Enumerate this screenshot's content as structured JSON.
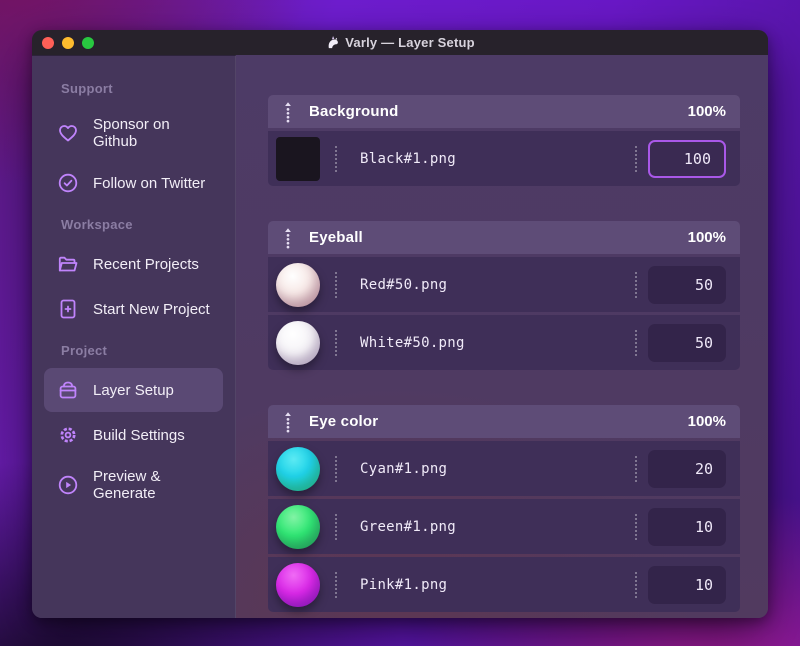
{
  "window": {
    "title": "Varly — Layer Setup",
    "traffic_lights": {
      "close": "#ff5f57",
      "minimize": "#febc2e",
      "zoom": "#28c840"
    }
  },
  "colors": {
    "accent": "#a958e8",
    "sidebar_icon": "#c084fc",
    "group_header_bg": "#5e4c77",
    "row_bg": "#3f2f58",
    "sidebar_bg": "#45365b"
  },
  "sidebar": {
    "sections": [
      {
        "label": "Support",
        "items": [
          {
            "label": "Sponsor on Github",
            "icon": "heart-icon"
          },
          {
            "label": "Follow on Twitter",
            "icon": "badge-check-icon"
          }
        ]
      },
      {
        "label": "Workspace",
        "items": [
          {
            "label": "Recent Projects",
            "icon": "folder-open-icon"
          },
          {
            "label": "Start New Project",
            "icon": "document-plus-icon"
          }
        ]
      },
      {
        "label": "Project",
        "items": [
          {
            "label": "Layer Setup",
            "icon": "archive-box-icon",
            "active": true
          },
          {
            "label": "Build Settings",
            "icon": "gear-icon"
          },
          {
            "label": "Preview & Generate",
            "icon": "play-circle-icon"
          }
        ]
      }
    ]
  },
  "layers": {
    "groups": [
      {
        "name": "Background",
        "weight": "100%",
        "items": [
          {
            "file": "Black#1.png",
            "value": "100",
            "thumb": "thumb-black",
            "focused": true
          }
        ]
      },
      {
        "name": "Eyeball",
        "weight": "100%",
        "items": [
          {
            "file": "Red#50.png",
            "value": "50",
            "thumb": "thumb-red"
          },
          {
            "file": "White#50.png",
            "value": "50",
            "thumb": "thumb-white"
          }
        ]
      },
      {
        "name": "Eye color",
        "weight": "100%",
        "items": [
          {
            "file": "Cyan#1.png",
            "value": "20",
            "thumb": "thumb-cyan"
          },
          {
            "file": "Green#1.png",
            "value": "10",
            "thumb": "thumb-green"
          },
          {
            "file": "Pink#1.png",
            "value": "10",
            "thumb": "thumb-pink"
          }
        ]
      }
    ]
  }
}
